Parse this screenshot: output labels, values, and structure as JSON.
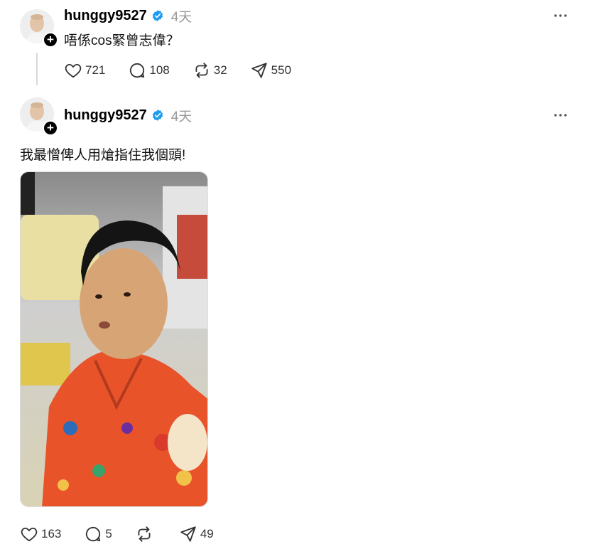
{
  "posts": [
    {
      "username": "hunggy9527",
      "time": "4天",
      "text": "唔係cos緊曾志偉？",
      "stats": {
        "likes": "721",
        "replies": "108",
        "reposts": "32",
        "shares": "550"
      }
    },
    {
      "username": "hunggy9527",
      "time": "4天",
      "text": "我最憎俾人用熗指住我個頭!",
      "stats": {
        "likes": "163",
        "replies": "5",
        "reposts": "",
        "shares": "49"
      }
    }
  ],
  "colors": {
    "verified": "#1d9bf0",
    "muted": "#999999",
    "icon": "#333333"
  },
  "icons": [
    "heart-icon",
    "comment-icon",
    "repost-icon",
    "share-icon",
    "more-icon",
    "verified-icon",
    "plus-icon"
  ]
}
